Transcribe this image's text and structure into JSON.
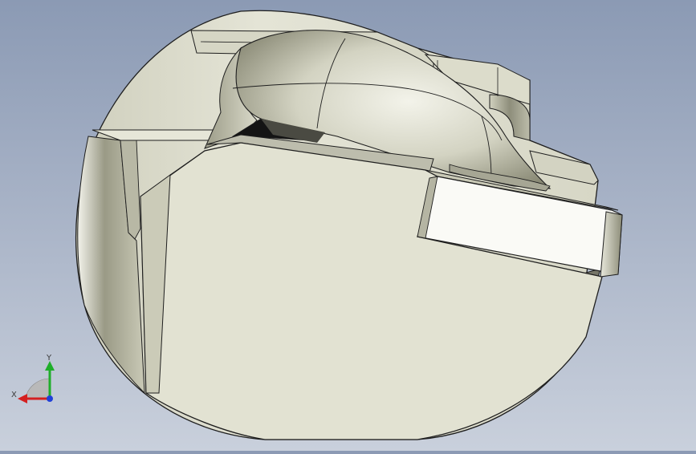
{
  "viewport": {
    "background_top": "#8b9ab4",
    "background_bottom": "#c9d0dc",
    "part_face_color": "#e2e2d2",
    "part_edge_color": "#1e1e1e"
  },
  "triad": {
    "x_label": "X",
    "y_label": "Y",
    "x_color": "#d42020",
    "y_color": "#1fae2a",
    "z_color": "#2040d8"
  }
}
